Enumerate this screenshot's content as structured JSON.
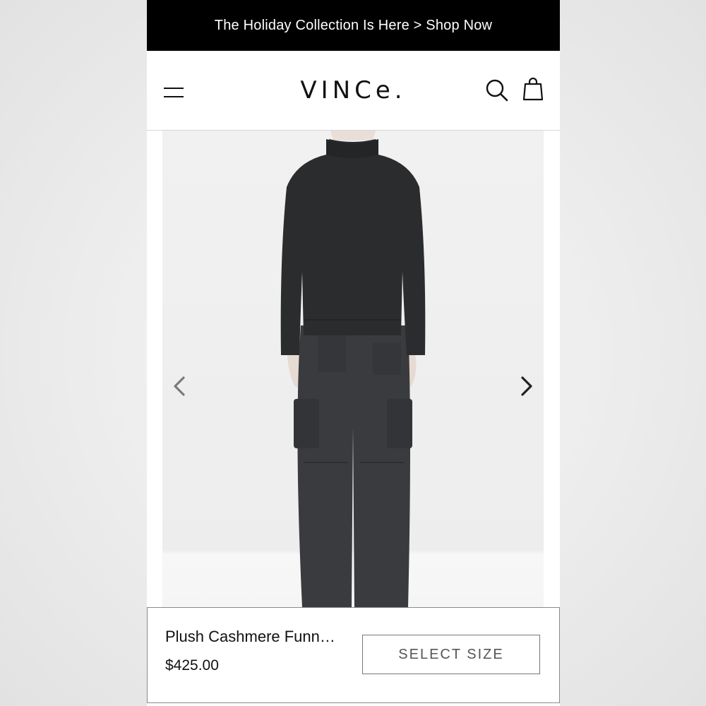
{
  "promo": {
    "text": "The Holiday Collection Is Here > Shop Now"
  },
  "header": {
    "logo": "VINCe."
  },
  "icons": {
    "menu": "hamburger-menu-icon",
    "search": "search-icon",
    "bag": "shopping-bag-icon",
    "prev": "chevron-left-icon",
    "next": "chevron-right-icon"
  },
  "product": {
    "name": "Plush Cashmere Funn…",
    "price": "$425.00",
    "select_size_label": "SELECT SIZE"
  },
  "colors": {
    "promo_bg": "#000000",
    "sweater": "#2b2c2e",
    "pants": "#3a3b3e"
  }
}
